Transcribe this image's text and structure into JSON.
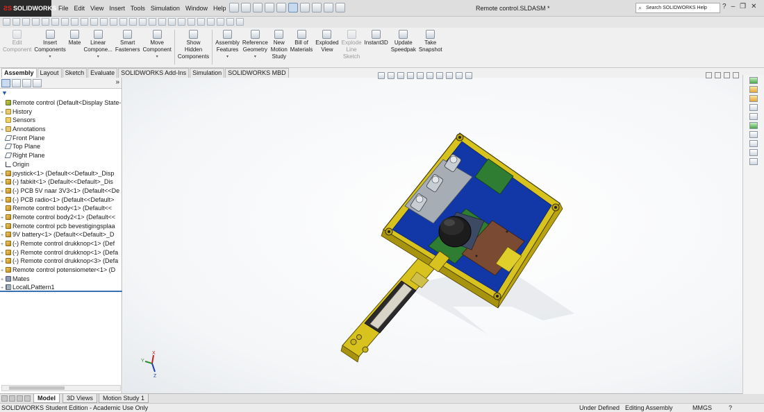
{
  "app": {
    "logo": "SOLIDWORKS",
    "document_title": "Remote control.SLDASM *"
  },
  "menu": [
    "File",
    "Edit",
    "View",
    "Insert",
    "Tools",
    "Simulation",
    "Window",
    "Help"
  ],
  "search": {
    "placeholder": "Search SOLIDWORKS Help"
  },
  "command_manager": [
    {
      "label": "Edit\nComponent",
      "disabled": true
    },
    {
      "label": "Insert\nComponents",
      "dropdown": true
    },
    {
      "label": "Mate"
    },
    {
      "label": "Linear\nCompone...",
      "dropdown": true
    },
    {
      "label": "Smart\nFasteners"
    },
    {
      "label": "Move\nComponent",
      "dropdown": true
    },
    {
      "sep": true
    },
    {
      "label": "Show\nHidden\nComponents"
    },
    {
      "sep": true
    },
    {
      "label": "Assembly\nFeatures",
      "dropdown": true
    },
    {
      "label": "Reference\nGeometry",
      "dropdown": true
    },
    {
      "label": "New\nMotion\nStudy"
    },
    {
      "label": "Bill of\nMaterials"
    },
    {
      "label": "Exploded\nView"
    },
    {
      "label": "Explode\nLine\nSketch",
      "disabled": true
    },
    {
      "label": "Instant3D"
    },
    {
      "label": "Update\nSpeedpak"
    },
    {
      "label": "Take\nSnapshot"
    }
  ],
  "command_tabs": [
    "Assembly",
    "Layout",
    "Sketch",
    "Evaluate",
    "SOLIDWORKS Add-Ins",
    "Simulation",
    "SOLIDWORKS MBD"
  ],
  "tree": [
    {
      "icon": "asm",
      "text": "Remote control  (Default<Display State-",
      "exp": ""
    },
    {
      "icon": "fold",
      "text": "History",
      "exp": "+"
    },
    {
      "icon": "sens",
      "text": "Sensors",
      "exp": ""
    },
    {
      "icon": "fold",
      "text": "Annotations",
      "exp": "+"
    },
    {
      "icon": "plane",
      "text": "Front Plane",
      "exp": ""
    },
    {
      "icon": "plane",
      "text": "Top Plane",
      "exp": ""
    },
    {
      "icon": "plane",
      "text": "Right Plane",
      "exp": ""
    },
    {
      "icon": "orig",
      "text": "Origin",
      "exp": ""
    },
    {
      "icon": "part",
      "text": "joystick<1> (Default<<Default>_Disp",
      "exp": "+"
    },
    {
      "icon": "part",
      "text": "(-) fabkit<1> (Default<<Default>_Dis",
      "exp": "+"
    },
    {
      "icon": "part",
      "text": "(-) PCB 5V naar 3V3<1> (Default<<De",
      "exp": "+"
    },
    {
      "icon": "part",
      "text": "(-) PCB radio<1> (Default<<Default>",
      "exp": "+"
    },
    {
      "icon": "part",
      "text": "Remote control body<1> (Default<<",
      "exp": ""
    },
    {
      "icon": "part",
      "text": "Remote control body2<1> (Default<<",
      "exp": "+"
    },
    {
      "icon": "part",
      "text": "Remote control pcb bevestigingsplaa",
      "exp": "+"
    },
    {
      "icon": "part",
      "text": "9V battery<1> (Default<<Default>_D",
      "exp": "+"
    },
    {
      "icon": "part",
      "text": "(-) Remote control drukknop<1> (Def",
      "exp": "+"
    },
    {
      "icon": "part",
      "text": "(-) Remote control drukknop<1> (Defa",
      "exp": "+"
    },
    {
      "icon": "part",
      "text": "(-) Remote control drukknop<3> (Defa",
      "exp": "+"
    },
    {
      "icon": "part",
      "text": "Remote control potensiometer<1> (D",
      "exp": "+"
    },
    {
      "icon": "mate",
      "text": "Mates",
      "exp": "+"
    },
    {
      "icon": "pat",
      "text": "LocalLPattern1",
      "exp": "+"
    }
  ],
  "bottom_tabs": [
    "Model",
    "3D Views",
    "Motion Study 1"
  ],
  "status": {
    "left": "SOLIDWORKS Student Edition - Academic Use Only",
    "defined": "Under Defined",
    "mode": "Editing Assembly",
    "units": "MMGS",
    "help": "?"
  },
  "triad": {
    "x": "X",
    "y": "Y",
    "z": "Z"
  },
  "colors": {
    "body_yellow": "#d8c21e",
    "cavity_blue": "#1238a8",
    "pcb_green": "#2e7d32",
    "pcb_brown": "#7a4a32",
    "accent": "#2559a8"
  }
}
